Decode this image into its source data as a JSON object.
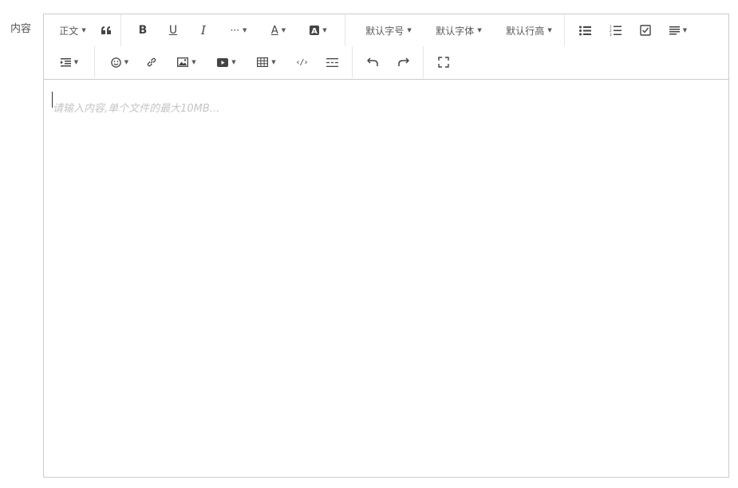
{
  "form": {
    "content_label": "内容"
  },
  "toolbar": {
    "header": "正文",
    "font_size": "默认字号",
    "font_family": "默认字体",
    "line_height": "默认行高",
    "more": "···"
  },
  "editor": {
    "placeholder": "请输入内容,单个文件的最大10MB..."
  }
}
